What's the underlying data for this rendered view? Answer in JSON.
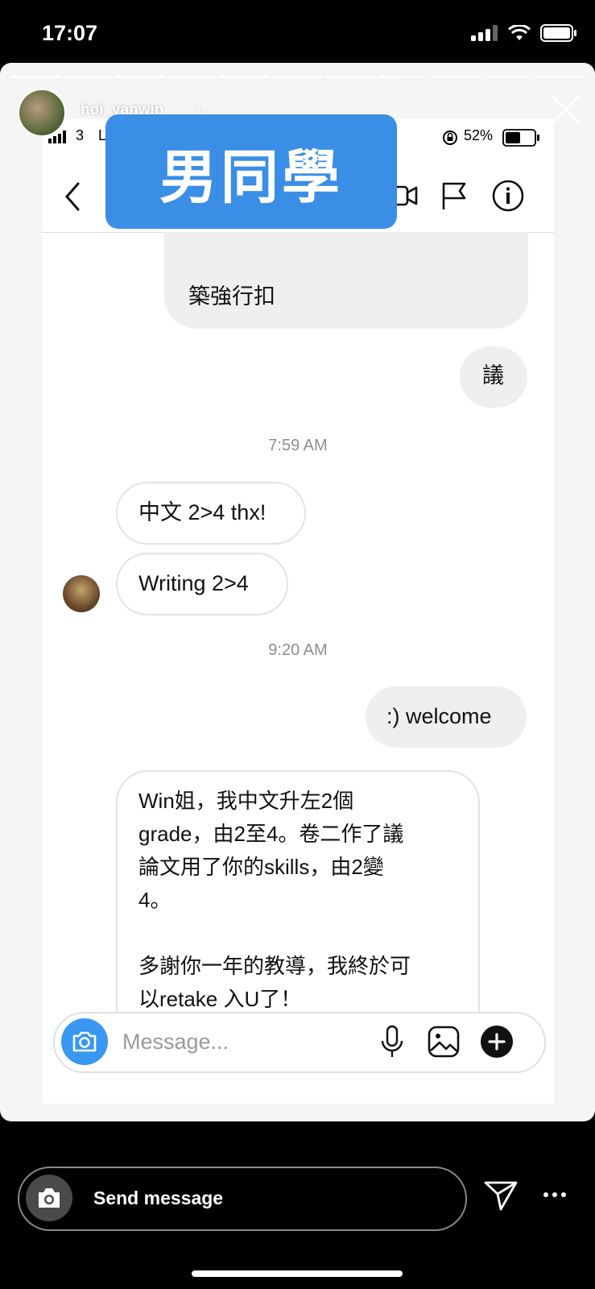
{
  "status_bar": {
    "time": "17:07"
  },
  "story": {
    "username": "hoi_yanwin",
    "time_ago": "2h",
    "progress": {
      "segments": 11,
      "current_index": 7,
      "current_fraction": 0.4
    }
  },
  "inner_screenshot": {
    "status": {
      "signal": "3",
      "carrier": "L",
      "battery": "52%"
    },
    "overlay_label": "男同學",
    "messages": [
      {
        "dir": "in",
        "text": "築強行扣"
      },
      {
        "dir": "out",
        "text": "議"
      },
      {
        "type": "time",
        "text": "7:59 AM"
      },
      {
        "dir": "in",
        "text": "中文 2>4 thx!"
      },
      {
        "dir": "in",
        "text": "Writing 2>4"
      },
      {
        "type": "time",
        "text": "9:20 AM"
      },
      {
        "dir": "out",
        "text": ":) welcome"
      },
      {
        "dir": "in",
        "lines": [
          "Win姐，我中文升左2個",
          "grade，由2至4。卷二作了議",
          "論文用了你的skills，由2變",
          "4。",
          "",
          "多謝你一年的教導，我終於可",
          "以retake 入U了！"
        ]
      }
    ],
    "composer": {
      "placeholder": "Message..."
    }
  },
  "reply_bar": {
    "placeholder": "Send message"
  },
  "colors": {
    "accent": "#3897f0",
    "overlay": "#3a8ee6"
  }
}
